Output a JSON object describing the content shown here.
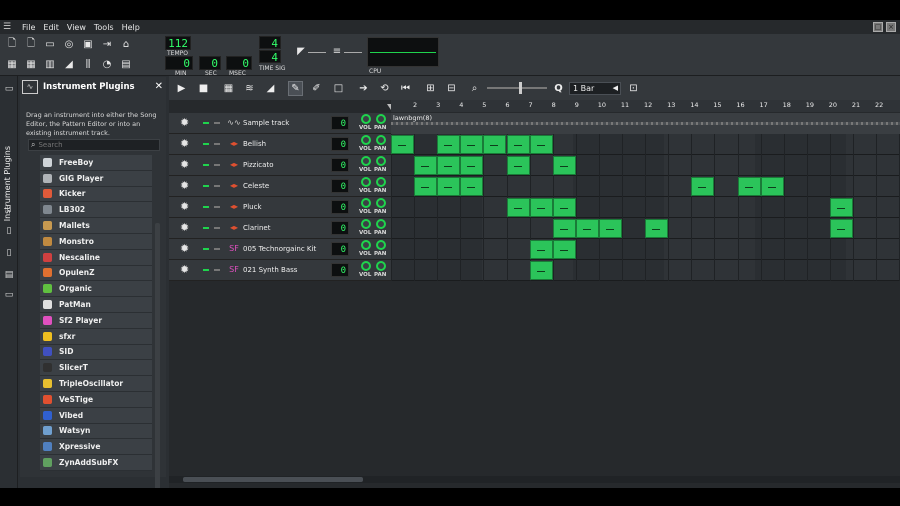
{
  "menubar": {
    "items": [
      "File",
      "Edit",
      "View",
      "Tools",
      "Help"
    ]
  },
  "toolbar": {
    "tempo": "112",
    "tempo_label": "TEMPO",
    "time_min": "0",
    "time_sec": "0",
    "time_msec": "0",
    "min_label": "MIN",
    "sec_label": "SEC",
    "msec_label": "MSEC",
    "timesig_num": "4",
    "timesig_den": "4",
    "timesig_label": "TIME SIG",
    "cpu_label": "CPU"
  },
  "sidebar": {
    "tab_label": "Instrument Plugins"
  },
  "plugins_panel": {
    "title": "Instrument Plugins",
    "description": "Drag an instrument into either the Song Editor, the Pattern Editor or into an existing instrument track.",
    "search_placeholder": "Search",
    "items": [
      {
        "label": "FreeBoy",
        "color": "#cfd4d8"
      },
      {
        "label": "GIG Player",
        "color": "#b0b4b8"
      },
      {
        "label": "Kicker",
        "color": "#e05a3a"
      },
      {
        "label": "LB302",
        "color": "#808890"
      },
      {
        "label": "Mallets",
        "color": "#c89a50"
      },
      {
        "label": "Monstro",
        "color": "#c08a40"
      },
      {
        "label": "Nescaline",
        "color": "#d04040"
      },
      {
        "label": "OpulenZ",
        "color": "#e07030"
      },
      {
        "label": "Organic",
        "color": "#60c040"
      },
      {
        "label": "PatMan",
        "color": "#e0e0e0"
      },
      {
        "label": "Sf2 Player",
        "color": "#e050c0"
      },
      {
        "label": "sfxr",
        "color": "#f0c020"
      },
      {
        "label": "SID",
        "color": "#4050c0"
      },
      {
        "label": "SlicerT",
        "color": "#303030"
      },
      {
        "label": "TripleOscillator",
        "color": "#e8c030"
      },
      {
        "label": "VeSTige",
        "color": "#e05030"
      },
      {
        "label": "Vibed",
        "color": "#3060d0"
      },
      {
        "label": "Watsyn",
        "color": "#70a0d0"
      },
      {
        "label": "Xpressive",
        "color": "#5080c0"
      },
      {
        "label": "ZynAddSubFX",
        "color": "#60a060"
      }
    ]
  },
  "song_editor": {
    "zoom_value": "1 Bar",
    "ticks": [
      "2",
      "3",
      "4",
      "5",
      "6",
      "7",
      "8",
      "9",
      "10",
      "11",
      "12",
      "13",
      "14",
      "15",
      "16",
      "17",
      "18",
      "19",
      "20",
      "21",
      "22"
    ],
    "bb_track_clip": "lawnbgm(8)",
    "tracks": [
      {
        "name": "Sample track",
        "volume": "0",
        "icon": "waveform-icon",
        "icon_color": "#cccccc"
      },
      {
        "name": "Bellish",
        "volume": "0",
        "icon": "triple-osc-icon",
        "icon_color": "#e05030"
      },
      {
        "name": "Pizzicato",
        "volume": "0",
        "icon": "triple-osc-icon",
        "icon_color": "#e05030"
      },
      {
        "name": "Celeste",
        "volume": "0",
        "icon": "triple-osc-icon",
        "icon_color": "#e05030"
      },
      {
        "name": "Pluck",
        "volume": "0",
        "icon": "triple-osc-icon",
        "icon_color": "#e05030"
      },
      {
        "name": "Clarinet",
        "volume": "0",
        "icon": "triple-osc-icon",
        "icon_color": "#e05030"
      },
      {
        "name": "005 Technorgainc Kit",
        "volume": "0",
        "icon": "sf2-icon",
        "icon_color": "#e050c0"
      },
      {
        "name": "021 Synth Bass",
        "volume": "0",
        "icon": "sf2-icon",
        "icon_color": "#e050c0"
      }
    ],
    "vol_label": "VOL",
    "pan_label": "PAN"
  },
  "colors": {
    "accent_green": "#2bc45a",
    "lcd_green": "#32ff6a",
    "background": "#2b2f33"
  }
}
